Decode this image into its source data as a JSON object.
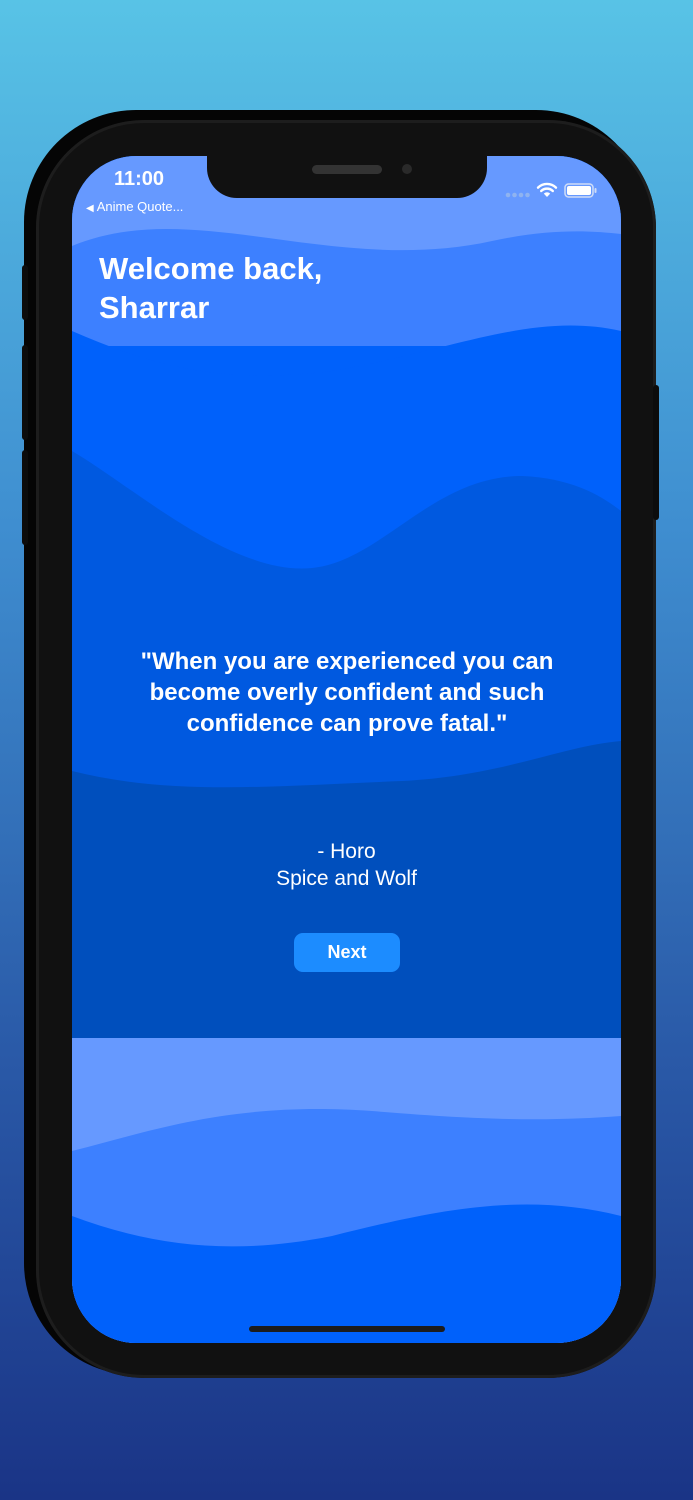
{
  "status_bar": {
    "time": "11:00",
    "back_app": "Anime Quote..."
  },
  "greeting": {
    "line1": "Welcome back,",
    "line2": "Sharrar"
  },
  "quote": {
    "text": "\"When you are experienced you can become overly confident and such confidence can prove fatal.\"",
    "author": "- Horo",
    "series": "Spice and Wolf"
  },
  "next_button": {
    "label": "Next"
  },
  "icons": [
    "back-arrow-icon",
    "cellular-signal-icon",
    "wifi-icon",
    "battery-icon"
  ],
  "colors": {
    "background_top": "#58c3e6",
    "background_bottom": "#1a3486",
    "wave_light": "#6699ff",
    "wave_mid": "#3d80ff",
    "wave_blue": "#0061fb",
    "wave_dark": "#0059e0",
    "wave_darkest": "#004fbd",
    "button": "#1c8cff"
  }
}
